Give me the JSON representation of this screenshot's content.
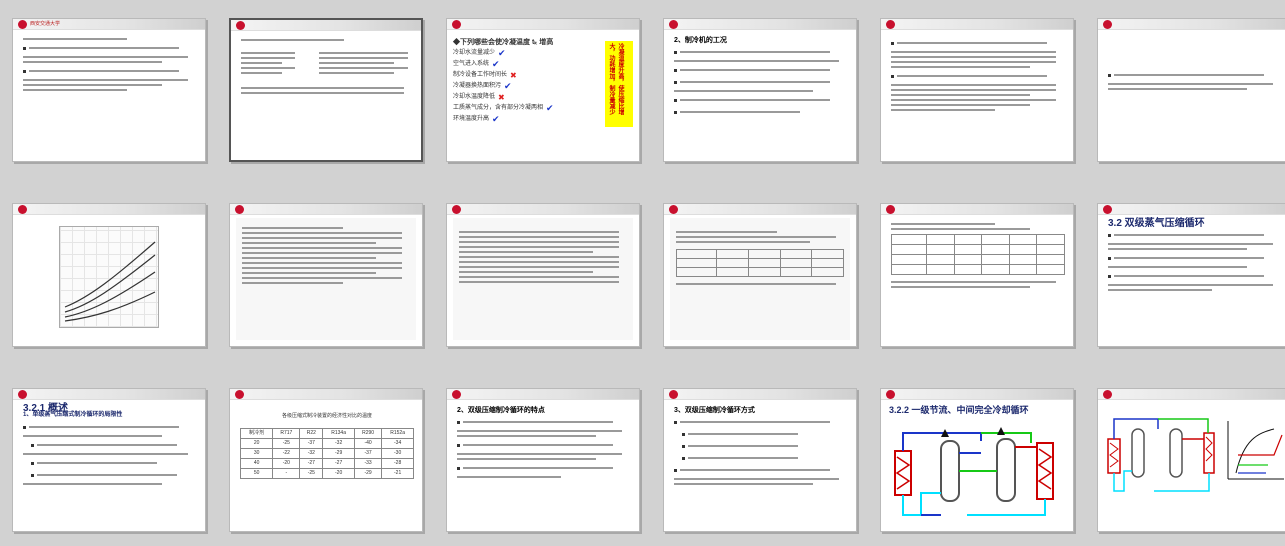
{
  "app": {
    "view": "slide-sorter"
  },
  "slides": [
    {
      "title": "",
      "header": ""
    },
    {
      "title": "",
      "header": ""
    },
    {
      "title": "",
      "header": ""
    },
    {
      "title": "2、制冷机的工况",
      "header": ""
    },
    {
      "title": "",
      "header": ""
    },
    {
      "title": "",
      "header": ""
    },
    {
      "title": "",
      "header": ""
    },
    {
      "title": "",
      "header": ""
    },
    {
      "title": "",
      "header": ""
    },
    {
      "title": "",
      "header": ""
    },
    {
      "title": "",
      "header": ""
    },
    {
      "title": "3.2 双级蒸气压缩循环",
      "header": ""
    },
    {
      "title": "3.2.1 概述",
      "header": "1、单级蒸气压缩式制冷循环的局限性"
    },
    {
      "title": "",
      "header": ""
    },
    {
      "title": "2、双级压缩制冷循环的特点",
      "header": ""
    },
    {
      "title": "3、双级压缩制冷循环方式",
      "header": ""
    },
    {
      "title": "3.2.2 一级节流、中间完全冷却循环",
      "header": ""
    },
    {
      "title": "",
      "header": ""
    }
  ],
  "uni_name": "西安交通大学",
  "slide3": {
    "intro": "◆下列哪些会使冷凝温度 tₖ 增高",
    "items": [
      {
        "text": "冷却水流量减少",
        "mark": "check"
      },
      {
        "text": "空气进入系统",
        "mark": "check"
      },
      {
        "text": "制冷设备工作时间长",
        "mark": "cross"
      },
      {
        "text": "冷凝器换热面积污",
        "mark": "check"
      },
      {
        "text": "冷却水温度降低",
        "mark": "cross"
      },
      {
        "text": "工质蒸气成分，含有部分冷凝两相",
        "mark": "check"
      },
      {
        "text": "环境温度升高",
        "mark": "check"
      }
    ],
    "side_note": "冷凝温度升高，使压缩比增大，功耗增加，制冷量减少"
  },
  "slide14": {
    "caption": "各级压缩式制冷装置的经济性对比的温度",
    "header": [
      "制冷剂",
      "R717",
      "R22",
      "R134a",
      "R290",
      "R152a"
    ],
    "rows": [
      [
        "20",
        "-25",
        "-37",
        "-32",
        "-40",
        "-34"
      ],
      [
        "30",
        "-22",
        "-32",
        "-29",
        "-37",
        "-30"
      ],
      [
        "40",
        "-20",
        "-27",
        "-27",
        "-33",
        "-28"
      ],
      [
        "50",
        "-",
        "-25",
        "-20",
        "-29",
        "-21"
      ]
    ]
  }
}
